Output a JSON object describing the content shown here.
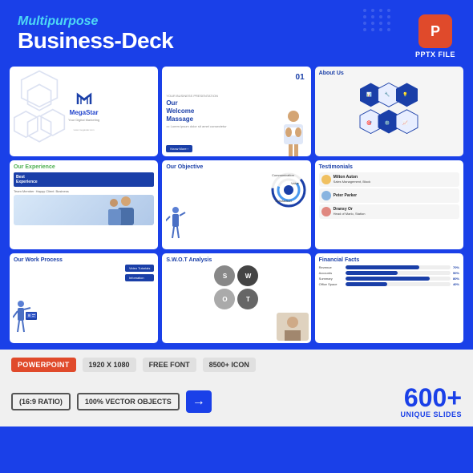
{
  "header": {
    "subtitle": "Multipurpose",
    "title": "Business-Deck",
    "pptx_icon_label": "P",
    "pptx_file_label": "PPTX FILE"
  },
  "slides": [
    {
      "id": "s1",
      "type": "logo",
      "logo_name": "MegaStar",
      "tagline": "Your Digital Marketing"
    },
    {
      "id": "s2",
      "type": "welcome",
      "title": "Our\nWelcome\nMassage",
      "number": "01"
    },
    {
      "id": "s3",
      "type": "about",
      "title": "About Us"
    },
    {
      "id": "s4",
      "type": "experience",
      "title": "Our Experience",
      "box_label": "Best\nExperience"
    },
    {
      "id": "s5",
      "type": "objective",
      "title": "Our Objective"
    },
    {
      "id": "s6",
      "type": "testimonials",
      "title": "Testimonials",
      "people": [
        {
          "name": "Milton Auton",
          "role": "Sales Management, Block"
        },
        {
          "name": "Peter Parker",
          "role": ""
        },
        {
          "name": "Dransy Or",
          "role": "Head of Marlo, Station"
        }
      ]
    },
    {
      "id": "s7",
      "type": "process",
      "title": "Our Work Process",
      "steps": [
        "Video Tutorials",
        "Infomation"
      ]
    },
    {
      "id": "s8",
      "type": "swot",
      "title": "S.W.O.T Analysis",
      "items": [
        {
          "label": "S",
          "color": "#888"
        },
        {
          "label": "W",
          "color": "#555"
        },
        {
          "label": "O",
          "color": "#aaa"
        }
      ]
    },
    {
      "id": "s9",
      "type": "financial",
      "title": "Financial Facts",
      "bars": [
        {
          "label": "Revenue",
          "pct": 70
        },
        {
          "label": "Accounts",
          "pct": 50
        },
        {
          "label": "Summary",
          "pct": 80
        },
        {
          "label": "Office Space",
          "pct": 40
        }
      ]
    }
  ],
  "info_bar": {
    "powerpoint_label": "POWERPOINT",
    "resolution": "1920 X 1080",
    "font": "FREE FONT",
    "icons": "8500+ ICON",
    "ratio": "(16:9 RATIO)",
    "vector": "100% VECTOR OBJECTS",
    "count_number": "600+",
    "count_label": "UNIQUE SLIDES"
  }
}
